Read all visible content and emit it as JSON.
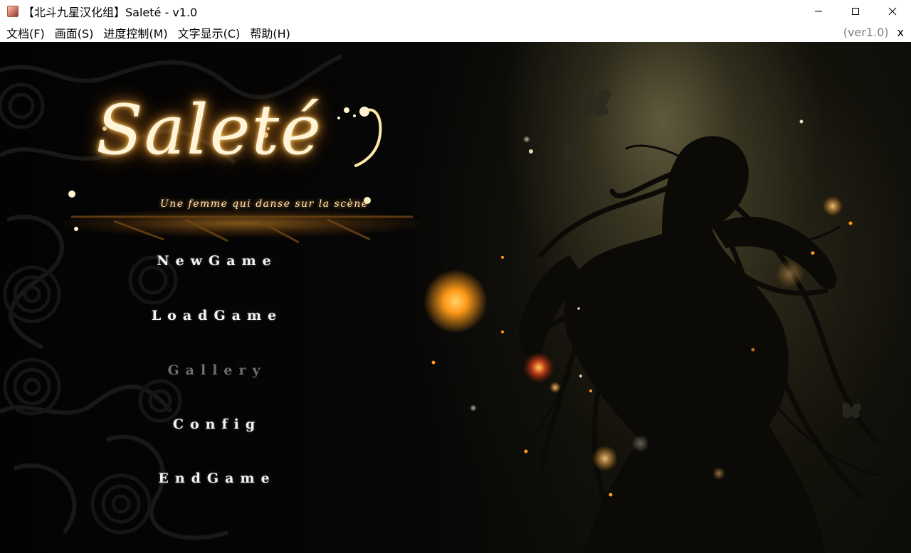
{
  "window": {
    "title": "【北斗九星汉化组】Saleté - v1.0"
  },
  "menubar": {
    "items": [
      {
        "label": "文档(F)"
      },
      {
        "label": "画面(S)"
      },
      {
        "label": "进度控制(M)"
      },
      {
        "label": "文字显示(C)"
      },
      {
        "label": "帮助(H)"
      }
    ],
    "version": "(ver1.0)",
    "close_label": "x"
  },
  "game": {
    "logo": {
      "title": "Saleté",
      "subtitle": "Une femme qui danse sur la scène"
    },
    "main_menu": [
      {
        "label": "NewGame",
        "enabled": true
      },
      {
        "label": "LoadGame",
        "enabled": true
      },
      {
        "label": "Gallery",
        "enabled": false
      },
      {
        "label": "Config",
        "enabled": true
      },
      {
        "label": "EndGame",
        "enabled": true
      }
    ]
  },
  "colors": {
    "menu_text": "#f3f3f3",
    "menu_disabled": "#6d6d6d",
    "logo_glow": "#e79a2a",
    "ember": "#ff9a1a"
  }
}
